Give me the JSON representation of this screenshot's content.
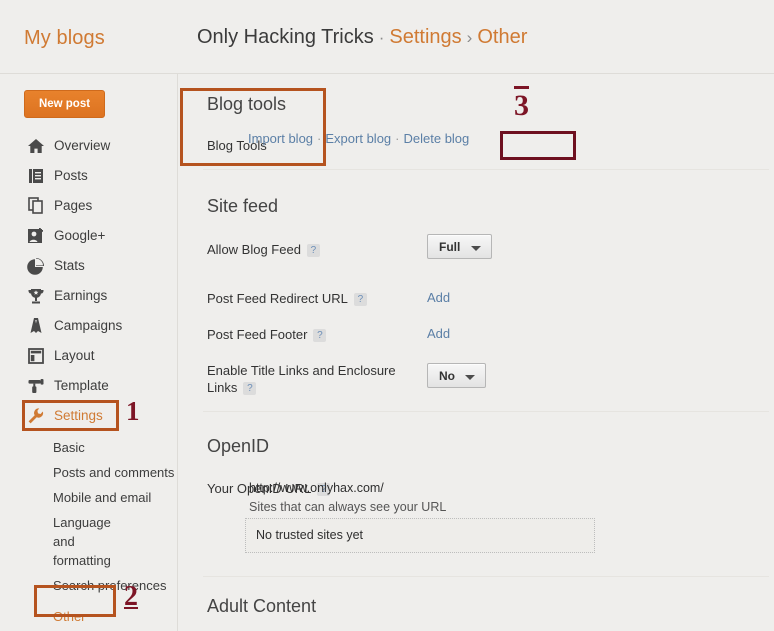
{
  "header": {
    "my_blogs_label": "My blogs",
    "blog_name": "Only Hacking Tricks",
    "separator_dot": "·",
    "separator_chevron": "›",
    "crumb_settings": "Settings",
    "crumb_other": "Other"
  },
  "sidebar": {
    "new_post_label": "New post",
    "items": [
      {
        "label": "Overview",
        "icon": "home-icon"
      },
      {
        "label": "Posts",
        "icon": "posts-icon"
      },
      {
        "label": "Pages",
        "icon": "pages-icon"
      },
      {
        "label": "Google+",
        "icon": "google-plus-icon"
      },
      {
        "label": "Stats",
        "icon": "stats-pie-icon"
      },
      {
        "label": "Earnings",
        "icon": "trophy-icon"
      },
      {
        "label": "Campaigns",
        "icon": "campaigns-icon"
      },
      {
        "label": "Layout",
        "icon": "layout-icon"
      },
      {
        "label": "Template",
        "icon": "template-brush-icon"
      },
      {
        "label": "Settings",
        "icon": "wrench-icon"
      }
    ],
    "sub_items": [
      {
        "label": "Basic"
      },
      {
        "label": "Posts and comments"
      },
      {
        "label": "Mobile and email"
      },
      {
        "label": "Language and formatting"
      },
      {
        "label": "Search preferences"
      },
      {
        "label": "Other"
      }
    ]
  },
  "main": {
    "blog_tools": {
      "heading": "Blog tools",
      "row_label": "Blog Tools",
      "import_label": "Import blog",
      "export_label": "Export blog",
      "delete_label": "Delete blog",
      "link_dot": "·"
    },
    "site_feed": {
      "heading": "Site feed",
      "allow_blog_feed_label": "Allow Blog Feed",
      "allow_blog_feed_value": "Full",
      "post_feed_redirect_label": "Post Feed Redirect URL",
      "post_feed_redirect_action": "Add",
      "post_feed_footer_label": "Post Feed Footer",
      "post_feed_footer_action": "Add",
      "enable_title_links_label": "Enable Title Links and Enclosure Links",
      "enable_title_links_value": "No",
      "help_glyph": "?"
    },
    "openid": {
      "heading": "OpenID",
      "url_label": "Your OpenID URL",
      "url_value": "http://www.onlyhax.com/",
      "sub_text": "Sites that can always see your URL",
      "trusted_sites_text": "No trusted sites yet"
    },
    "adult_content": {
      "heading": "Adult Content"
    }
  },
  "annotations": [
    {
      "number": "1"
    },
    {
      "number": "2"
    },
    {
      "number": "3"
    }
  ],
  "colors": {
    "accent_orange": "#d07a33",
    "button_orange": "#e07a26",
    "link_blue": "#5b7fa6",
    "anno_border": "#b5531f",
    "anno_border_dark": "#6e1020",
    "anno_number": "#7d1526",
    "page_bg": "#efeeec"
  }
}
